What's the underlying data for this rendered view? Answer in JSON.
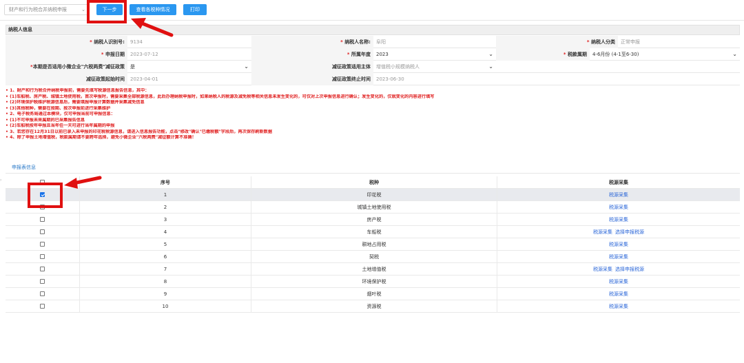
{
  "toolbar": {
    "declare_type": "财产和行为税合并纳税申报",
    "next_label": "下一步",
    "view_label": "查看各税种情况",
    "print_label": "打印"
  },
  "info": {
    "section_title": "纳税人信息",
    "taxpayer_id_label": "纳税人识别号:",
    "taxpayer_id_value": "9134",
    "taxpayer_name_label": "纳税人名称:",
    "taxpayer_name_value": "阜阳",
    "taxpayer_class_label": "纳税人分类",
    "taxpayer_class_value": "正常申报",
    "declare_date_label": "申报日期",
    "declare_date_value": "2023-07-12",
    "year_label": "所属年度",
    "year_value": "2023",
    "period_label": "税款属期",
    "period_value": "4-6月份 (4-1至6-30)",
    "policy_label": "本期是否适用小微企业\"六税两费\"减征政策",
    "policy_value": "是",
    "subject_label": "减征政策适用主体",
    "subject_value": "增值税小规模纳税人",
    "start_label": "减征政策起始时间",
    "start_value": "2023-04-01",
    "end_label": "减征政策终止时间",
    "end_value": "2023-06-30",
    "required_mark": "*"
  },
  "notes": [
    "• 1、财产和行为税合并纳税申报前，需要先填写税源信息报告信息，其中：",
    "• (1)车船税、房产税、城镇土地使用税，首次申报时，需要采集全部税源信息，此后办理纳税申报时，如果纳税人的税源及减免税等相关信息未发生变化的，可仅对上次申报信息进行确认；发生变化的，仅就变化的内容进行填写",
    "• (2)环境保护税维护税源信息后，需要填报申报计算数据并采集减免信息",
    "• (3)其他税种，需要在按期、按次申报前进行采集维护",
    "• 2、电子税务局通过本模块，仅可申报当前可申报信息：",
    "• (1)不可申报未来属期的已采集报告信息",
    "• (2)车船税按年申报且当年任一天可进行当年属期的申报",
    "• 3、若您存在12月31日以前已录入未申报的印花税税源信息，请进入信息报告功能，点击\"修改\"确认\"已缴税额\"字段后，再次保存刷新数据",
    "• 4、除了申报土地增值税，税款属期请不要跨年选择，避免小微企业\"六税两费\"减征额计算不准确！"
  ],
  "table": {
    "section_title": "申报表信息",
    "side_mark": "›",
    "headers": {
      "seq": "序号",
      "tax": "税种",
      "collect": "税源采集"
    },
    "collect_label": "税源采集",
    "choose_label": "选择申报税源",
    "rows": [
      {
        "seq": "1",
        "tax": "印花税",
        "checked": true,
        "choose": false
      },
      {
        "seq": "2",
        "tax": "城镇土地使用税",
        "checked": false,
        "choose": false
      },
      {
        "seq": "3",
        "tax": "房产税",
        "checked": false,
        "choose": false
      },
      {
        "seq": "4",
        "tax": "车船税",
        "checked": false,
        "choose": true
      },
      {
        "seq": "5",
        "tax": "耕地占用税",
        "checked": false,
        "choose": false
      },
      {
        "seq": "6",
        "tax": "契税",
        "checked": false,
        "choose": false
      },
      {
        "seq": "7",
        "tax": "土地增值税",
        "checked": false,
        "choose": true
      },
      {
        "seq": "8",
        "tax": "环境保护税",
        "checked": false,
        "choose": false
      },
      {
        "seq": "9",
        "tax": "烟叶税",
        "checked": false,
        "choose": false
      },
      {
        "seq": "10",
        "tax": "资源税",
        "checked": false,
        "choose": false
      }
    ]
  },
  "colors": {
    "primary": "#2a97f0",
    "alert_red": "#e02020",
    "link_blue": "#2a66d8",
    "annotation_red": "#e01010"
  }
}
